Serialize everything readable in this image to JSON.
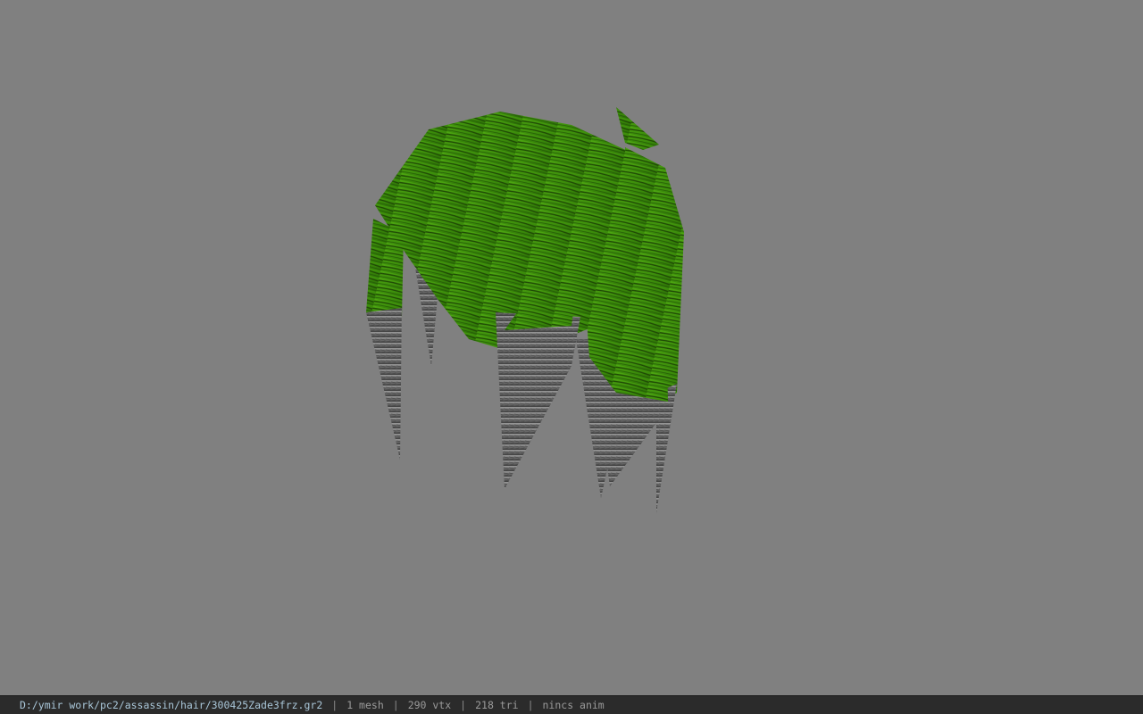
{
  "viewer": {
    "background_color": "#808080",
    "model_primary_color": "#3f8f0c",
    "model_tip_color": "#7a7a7a"
  },
  "status_bar": {
    "file_path": "D:/ymir work/pc2/assassin/hair/300425Zade3frz.gr2",
    "separator": "|",
    "mesh_count": "1 mesh",
    "vertex_count": "290 vtx",
    "triangle_count": "218 tri",
    "anim_status": "nincs anim"
  }
}
